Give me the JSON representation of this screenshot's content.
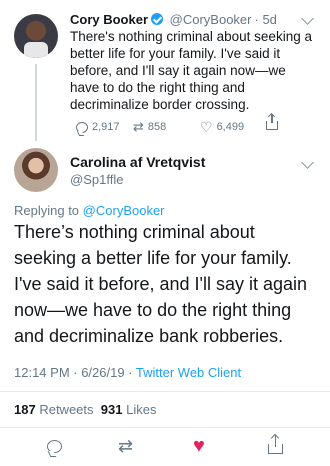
{
  "parent_tweet": {
    "author_name": "Cory Booker",
    "handle": "@CoryBooker",
    "age": "· 5d",
    "text": "There's nothing criminal about seeking a better life for your family. I've said it before, and I'll say it again now—we have to do the right thing and decriminalize border crossing.",
    "reply_count": "2,917",
    "retweet_count": "858",
    "like_count": "6,499"
  },
  "main_tweet": {
    "author_name": "Carolina af Vretqvist",
    "handle": "@Sp1ffle",
    "replying_prefix": "Replying to",
    "replying_to": "@CoryBooker",
    "text": "There’s nothing criminal about seeking a better life for your family. I've said it before, and I'll say it again now—we have to do the right thing and decriminalize bank robberies.",
    "time": "12:14 PM · 6/26/19 · ",
    "client": "Twitter Web Client",
    "retweets_value": "187",
    "retweets_label": "Retweets",
    "likes_value": "931",
    "likes_label": "Likes"
  },
  "colors": {
    "accent": "#1da1f2",
    "muted": "#657786",
    "liked": "#e0245e"
  },
  "icons": {
    "parent_actions": [
      "reply-icon",
      "retweet-icon",
      "heart-icon",
      "share-icon"
    ],
    "bottom_actions": [
      "reply-icon",
      "retweet-icon",
      "heart-filled-icon",
      "share-icon"
    ]
  }
}
